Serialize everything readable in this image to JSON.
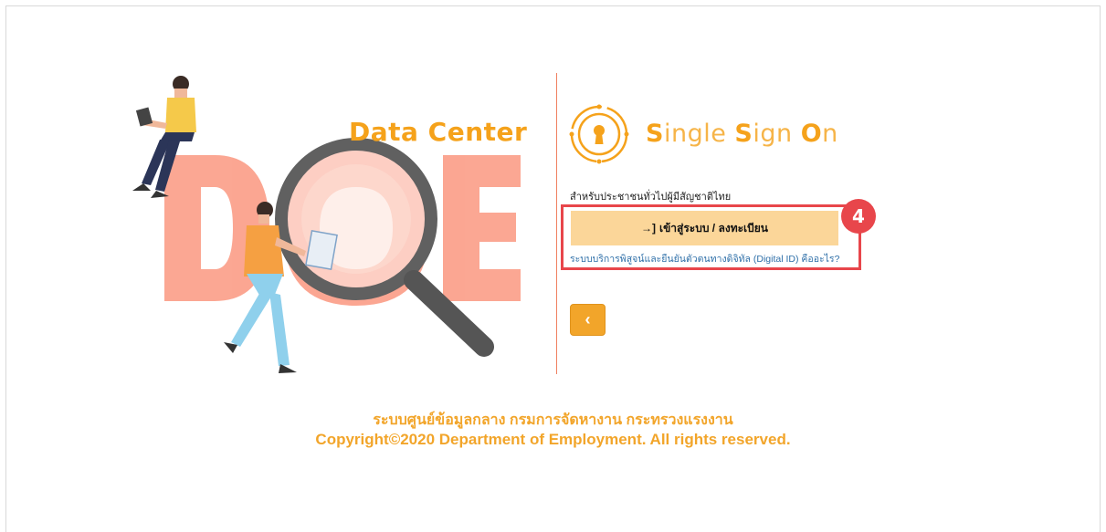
{
  "branding": {
    "data_center_title": "Data Center",
    "logo_letters": "DOE",
    "sso_title": {
      "s1": "S",
      "r1": "ingle ",
      "s2": "S",
      "r2": "ign ",
      "s3": "O",
      "r3": "n"
    }
  },
  "login": {
    "citizen_label": "สำหรับประชาชนทั่วไปผู้มีสัญชาติไทย",
    "button_icon": "→]",
    "button_label": "เข้าสู่ระบบ / ลงทะเบียน",
    "digital_id_link": "ระบบบริการพิสูจน์และยืนยันตัวตนทางดิจิทัล (Digital ID) คืออะไร?",
    "step_number": "4",
    "back_icon": "‹"
  },
  "footer": {
    "thai_line": "ระบบศูนย์ข้อมูลกลาง กรมการจัดหางาน กระทรวงแรงงาน",
    "copyright": "Copyright©2020 Department of Employment. All rights reserved."
  },
  "colors": {
    "accent": "#f2a52a",
    "highlight": "#e8464b",
    "button_bg": "#fbd699",
    "link": "#2e6fa8",
    "logo_salmon": "#fb9d87"
  }
}
